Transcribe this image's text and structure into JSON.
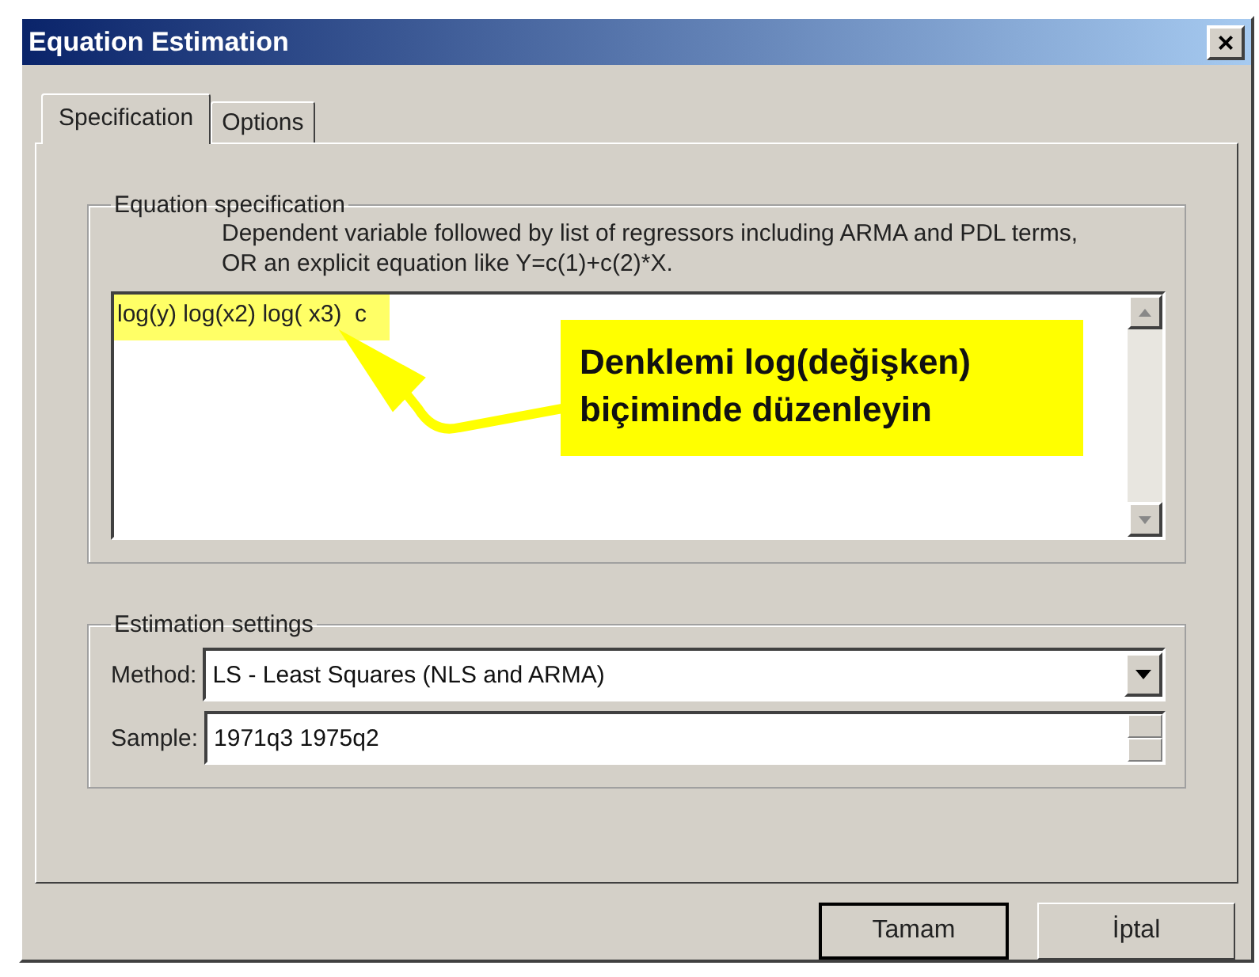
{
  "window": {
    "title": "Equation Estimation",
    "close": "×"
  },
  "tabs": [
    {
      "label": "Specification",
      "selected": true
    },
    {
      "label": "Options",
      "selected": false
    }
  ],
  "equation_group": {
    "title": "Equation specification",
    "hint": "Dependent variable followed by list of regressors including ARMA and PDL terms, OR an explicit equation like Y=c(1)+c(2)*X.",
    "value": "log(y) log(x2) log( x3)  c",
    "highlighted": true
  },
  "callout": {
    "text": "Denklemi log(değişken) biçiminde düzenleyin"
  },
  "settings_group": {
    "title": "Estimation settings",
    "method_label": "Method:",
    "method_value": "LS  -  Least Squares (NLS and ARMA)",
    "sample_label": "Sample:",
    "sample_value": "1971q3 1975q2"
  },
  "buttons": [
    {
      "label": "Tamam",
      "default": true
    },
    {
      "label": "İptal",
      "default": false
    }
  ]
}
